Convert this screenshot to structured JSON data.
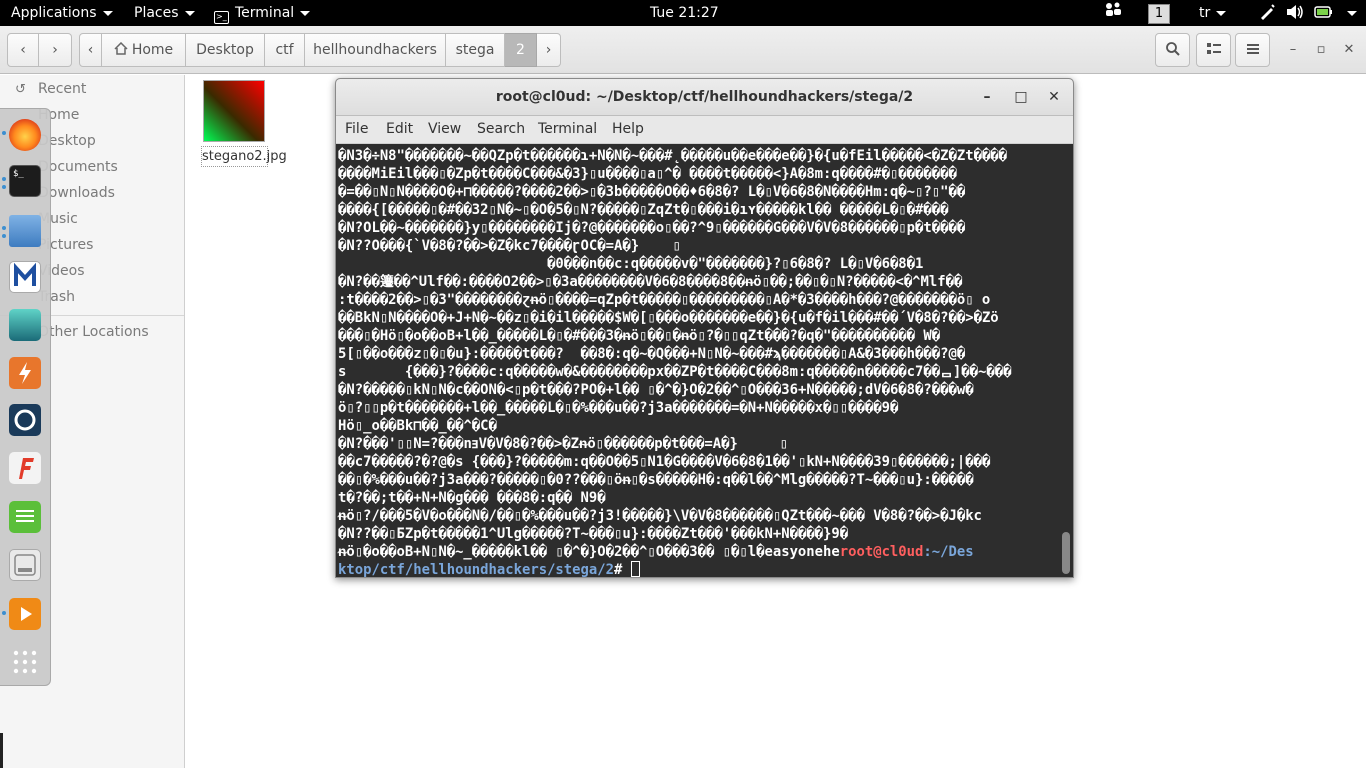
{
  "topbar": {
    "applications": "Applications",
    "places": "Places",
    "terminal": "Terminal",
    "clock": "Tue 21:27",
    "workspace": "1",
    "keyboard_layout": "tr"
  },
  "headerbar": {
    "breadcrumbs": [
      "Home",
      "Desktop",
      "ctf",
      "hellhoundhackers",
      "stega",
      "2"
    ]
  },
  "sidebar": {
    "items": [
      "Recent",
      "Home",
      "Desktop",
      "Documents",
      "Downloads",
      "Music",
      "Pictures",
      "Videos",
      "Trash"
    ],
    "other_locations": "Other Locations"
  },
  "dock": {
    "apps": [
      "firefox-icon",
      "terminal-icon",
      "files-icon",
      "metasploit-icon",
      "avatar-icon",
      "burpsuite-icon",
      "maltego-icon",
      "faraday-icon",
      "text-editor-icon",
      "cherrytree-icon",
      "media-player-icon",
      "app-grid-icon"
    ]
  },
  "desktop_file": {
    "name": "stegano2.jpg"
  },
  "terminal": {
    "title": "root@cl0ud: ~/Desktop/ctf/hellhoundhackers/stega/2",
    "menu": [
      "File",
      "Edit",
      "View",
      "Search",
      "Terminal",
      "Help"
    ],
    "lines": [
      "�N3�÷N8\"�������~��QZp�t������ɿ+N�N�~���#˛�����u��e���e��}�{u�fEil�����<�Z�Zt����",
      "����MiEil���▯�Zp�t����C���&�3}▯u����▯a▯^� ����t�����<}A�8m:q����#�▯�������",
      "�=��▯N▯N����O�+⊓�����?����2��>▯�3b�����O��♦6�8�? L�▯V�6�8�N����Hm:q�~▯?▯\"��",
      "����{[�����▯�#��32▯N�~▯�O�5�▯N?�����▯ZqZt�▯���i�ıʏ�����kl�� �����L�▯�#���",
      "�N?OL��~�������}y▯��������Ij�?@�������o▯��?^9▯������G���V�V�8������▯p�t����",
      "�N??O���{`V�8�?��>�Z�kc7����ɽOC�=A�}    ▯",
      "                         �0���n��ϲ:q�����v�\"�������}?▯6�8�? L�▯V�6�8�1",
      "�N?��䉦��^Ulf��:����O2��>▯�3a��������V�6�8����8��ᵰö▯��;��▯�▯N?�����<�^Mlf��",
      ":t����2��>▯�3\"��������ɀᵰö▯����=qZp�t�����▯���������▯A�*�3����h���?@�������ö▯ o",
      "��BkN▯N����O�+J+N�~��z▯�i�il�����$W�[▯���o�������e��}�{u�f�il���#��´V�8�?��>�Zö",
      "���▯�Hö▯�o��oB+l��_�����L�▯�#���3�ᵰö▯��▯�ᵰö▯?�▯▯qZt���?�q�\"���������� W�",
      "5[▯��o���z▯�▯�u}:�����t���?  ��8�:q�~�Q���+N▯N�~���#ϡ�������▯A&�3���h���?@�",
      "s       {���}?����ϲ:q�����w�&��������px��ZP�t����C���8m:q�����n�����c7��ᆷ]��~���",
      "�N?�����▯kN▯N�c��ON�<▯p�t���?PO�+l�� ▯�^�}O�2��^▯O���36+N�����;dV�6�8�?���w�",
      "ö▯?▯▯p�t�������+l��_�����L�▯�%���u��?j3a�������=�N+N�����x�▯▯����9�",
      "Hö▯_o��Bk⊓��_��^�C�",
      "�N?���'▯▯N=?���nⱻV�V�8�?��>�Zᵰö▯������p�t���=A�}     ▯",
      "��c7�����?�?@�s {���}?�����m:q��O��5▯N1�G����V�6�8�1��'▯kN+N����39▯������;|���",
      "��▯�%���u��?j3a���?�����▯�0??���▯öᵰ▯�s�����H�:q��l��^Mlg�����?T~���▯u}:�����",
      "t�?��;t��+N+N�g��� ���8�:q�� N9�",
      "ᵰö▯?/���5�V�o���N�/��▯�%���u��?j3!�����}\\V�V�8������▯QZt���~��� V�8�?��>�J�kc",
      "�N??��▯ƂZp�t�����1^Ulg�����?T~���▯u}:����Zt���'���kN+N����}9�",
      "ᵰö▯�o��oB+N▯N�~_�����kl�� ▯�^�}O�2��^▯O���3�� ▯�▯l�easyonehe"
    ],
    "prompt_user": "root@cl0ud",
    "prompt_path_part1": ":~/Des",
    "prompt_path_part2": "ktop/ctf/hellhoundhackers/stega/2",
    "prompt_symbol": "# "
  }
}
